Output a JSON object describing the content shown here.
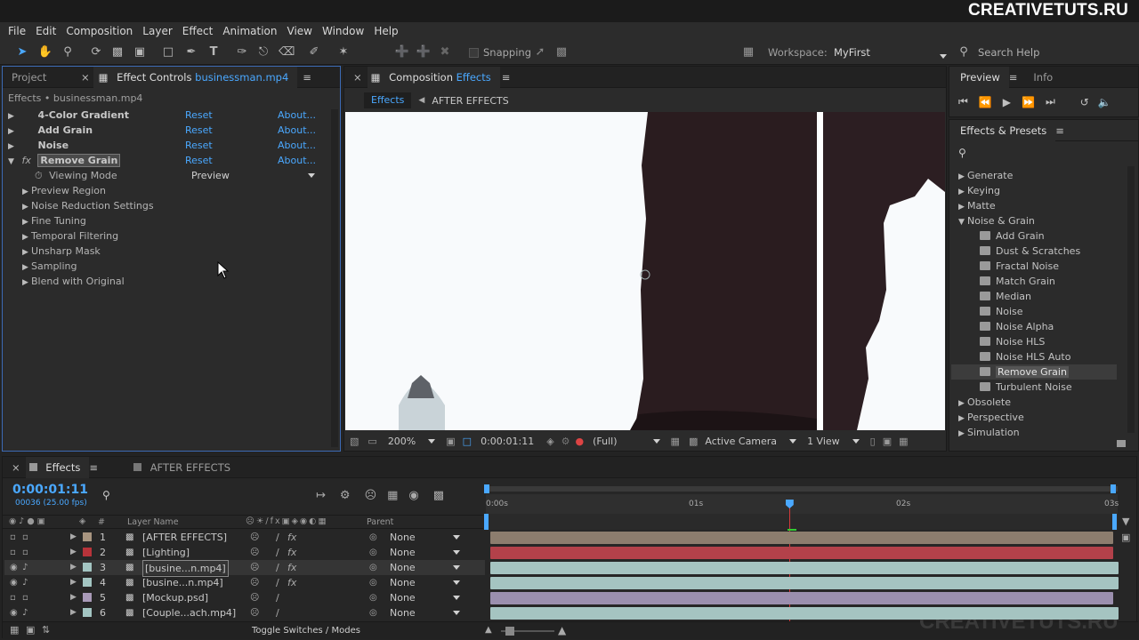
{
  "brand": "CREATIVETUTS.RU",
  "watermark": "CREATIVETUTS.RU",
  "menu": [
    "File",
    "Edit",
    "Composition",
    "Layer",
    "Effect",
    "Animation",
    "View",
    "Window",
    "Help"
  ],
  "toolbar": {
    "snapping": "Snapping",
    "workspace_label": "Workspace:",
    "workspace_value": "MyFirst",
    "search_help": "Search Help"
  },
  "project_tab": "Project",
  "effect_controls": {
    "tab_label": "Effect Controls",
    "tab_file": "businessman.mp4",
    "breadcrumb": "Effects • businessman.mp4",
    "reset": "Reset",
    "about": "About...",
    "effects": [
      "4-Color Gradient",
      "Add Grain",
      "Noise",
      "Remove Grain"
    ],
    "viewing_mode_label": "Viewing Mode",
    "viewing_mode_value": "Preview",
    "groups": [
      "Preview Region",
      "Noise Reduction Settings",
      "Fine Tuning",
      "Temporal Filtering",
      "Unsharp Mask",
      "Sampling",
      "Blend with Original"
    ]
  },
  "composition": {
    "tab_prefix": "Composition",
    "tab_name": "Effects",
    "nav_active": "Effects",
    "nav_next": "AFTER EFFECTS",
    "zoom": "200%",
    "timecode": "0:00:01:11",
    "resolution": "(Full)",
    "camera": "Active Camera",
    "views": "1 View"
  },
  "preview_tabs": [
    "Preview",
    "Info"
  ],
  "effects_presets": {
    "title": "Effects & Presets",
    "categories_top": [
      "Generate",
      "Keying",
      "Matte"
    ],
    "open_category": "Noise & Grain",
    "items": [
      "Add Grain",
      "Dust & Scratches",
      "Fractal Noise",
      "Match Grain",
      "Median",
      "Noise",
      "Noise Alpha",
      "Noise HLS",
      "Noise HLS Auto",
      "Remove Grain",
      "Turbulent Noise"
    ],
    "selected": "Remove Grain",
    "categories_bottom": [
      "Obsolete",
      "Perspective",
      "Simulation"
    ]
  },
  "timeline": {
    "tab_active": "Effects",
    "tab_other": "AFTER EFFECTS",
    "timecode": "0:00:01:11",
    "frames": "00036 (25.00 fps)",
    "col_num": "#",
    "col_layer_name": "Layer Name",
    "col_parent": "Parent",
    "ruler": [
      "0:00s",
      "01s",
      "02s",
      "03s"
    ],
    "playhead_fraction": 0.48,
    "toggle": "Toggle Switches / Modes",
    "layers": [
      {
        "num": "1",
        "name": "[AFTER EFFECTS]",
        "parent": "None",
        "color": "#a89580",
        "bar": "#8c7d6e",
        "fx": true
      },
      {
        "num": "2",
        "name": "[Lighting]",
        "parent": "None",
        "color": "#b8333a",
        "bar": "#b3414a",
        "fx": true
      },
      {
        "num": "3",
        "name": "[busine...n.mp4]",
        "parent": "None",
        "color": "#a3c5c2",
        "bar": "#a5c4c1",
        "fx": true
      },
      {
        "num": "4",
        "name": "[busine...n.mp4]",
        "parent": "None",
        "color": "#a3c5c2",
        "bar": "#a5c4c1",
        "fx": true
      },
      {
        "num": "5",
        "name": "[Mockup.psd]",
        "parent": "None",
        "color": "#a99ab8",
        "bar": "#9b8fae",
        "fx": false
      },
      {
        "num": "6",
        "name": "[Couple...ach.mp4]",
        "parent": "None",
        "color": "#a3c5c2",
        "bar": "#a5c4c1",
        "fx": false
      }
    ]
  },
  "colors": {
    "accent": "#4aa8ff",
    "playhead": "#d43a3a",
    "panel": "#2b2b2b"
  }
}
